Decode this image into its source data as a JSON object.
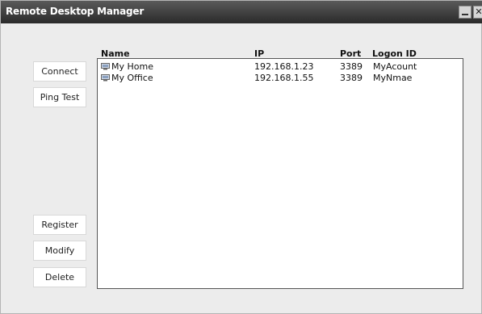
{
  "window": {
    "title": "Remote Desktop Manager"
  },
  "buttons": {
    "connect": "Connect",
    "ping_test": "Ping Test",
    "register": "Register",
    "modify": "Modify",
    "delete": "Delete"
  },
  "table": {
    "columns": [
      "Name",
      "IP",
      "Port",
      "Logon ID"
    ],
    "rows": [
      {
        "icon": "computer-icon",
        "name": "My Home",
        "ip": "192.168.1.23",
        "port": "3389",
        "logon_id": "MyAcount"
      },
      {
        "icon": "computer-icon",
        "name": "My Office",
        "ip": "192.168.1.55",
        "port": "3389",
        "logon_id": "MyNmae"
      }
    ]
  },
  "icons": {
    "minimize": "minimize-icon",
    "close": "close-icon",
    "row_icon": "computer-icon"
  },
  "colors": {
    "titlebar": "#2a2a2a",
    "window_bg": "#ececec",
    "list_bg": "#ffffff"
  }
}
